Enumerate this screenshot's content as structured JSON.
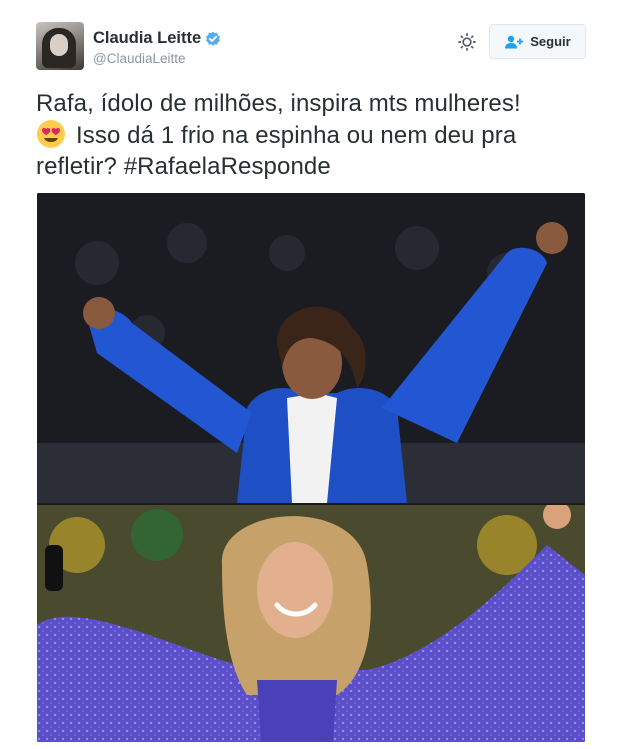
{
  "user": {
    "display_name": "Claudia Leitte",
    "handle": "@ClaudiaLeitte",
    "verified": true
  },
  "actions": {
    "settings_icon": "gear-icon",
    "follow_label": "Seguir",
    "follow_icon": "add-user-icon"
  },
  "tweet": {
    "line1": "Rafa, ídolo de milhões, inspira mts mulheres!",
    "emoji": "heart-eyes-emoji",
    "line2": "Isso dá 1 frio na espinha ou nem deu pra",
    "line3": "refletir? #RafaelaResponde"
  },
  "media": {
    "photos": [
      {
        "subject": "judoka-blue-gi"
      },
      {
        "subject": "singer-sparkly-dress"
      }
    ]
  },
  "colors": {
    "text": "#292f33",
    "muted": "#8899a6",
    "verified_blue": "#55acee",
    "button_bg": "#f5f8fa",
    "button_border": "#e1e8ed"
  }
}
